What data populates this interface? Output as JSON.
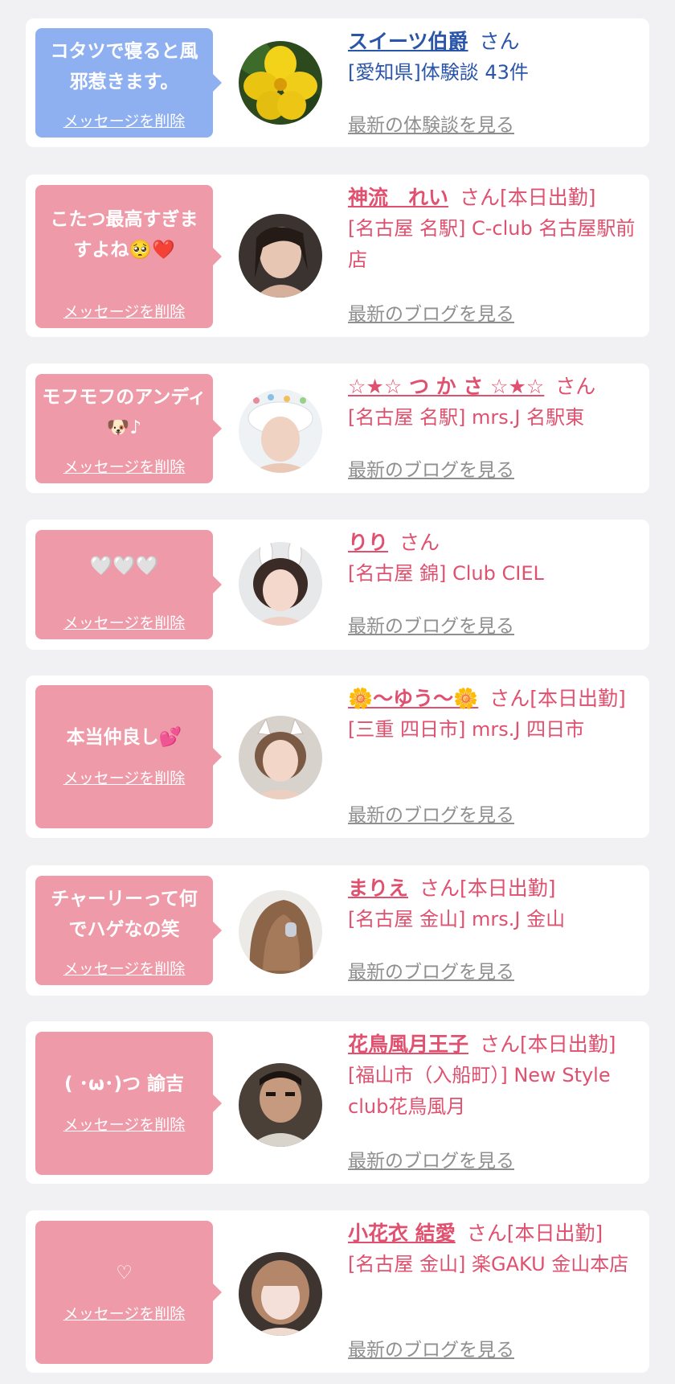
{
  "messages": [
    {
      "bubble": "コタツで寝ると風邪惹きます。",
      "delete_label": "メッセージを削除",
      "name": "スイーツ伯爵",
      "suffix": "さん",
      "location": "[愛知県]体験談 43件",
      "link": "最新の体験談を見る",
      "theme": "blue",
      "avatar": "yellow-hibiscus-flower"
    },
    {
      "bubble": "こたつ最高すぎますよね🥺❤️",
      "delete_label": "メッセージを削除",
      "name": "神流　れい",
      "suffix": "さん[本日出勤]",
      "location": "[名古屋 名駅] C-club 名古屋駅前店",
      "link": "最新のブログを見る",
      "theme": "pink",
      "avatar": "woman-portrait"
    },
    {
      "bubble": "モフモフのアンディ🐶♪",
      "delete_label": "メッセージを削除",
      "name": "☆★☆ つ か さ ☆★☆",
      "suffix": "さん",
      "location": "[名古屋 名駅] mrs.J 名駅東",
      "link": "最新のブログを見る",
      "theme": "pink",
      "avatar": "woman-portrait"
    },
    {
      "bubble": "🤍🤍🤍",
      "delete_label": "メッセージを削除",
      "name": "りり",
      "suffix": "さん",
      "location": "[名古屋 錦] Club CIEL",
      "link": "最新のブログを見る",
      "theme": "pink",
      "avatar": "woman-portrait"
    },
    {
      "bubble": "本当仲良し💕",
      "delete_label": "メッセージを削除",
      "name": "🌼〜ゆう〜🌼",
      "suffix": "さん[本日出勤]",
      "location": "[三重 四日市] mrs.J 四日市",
      "link": "最新のブログを見る",
      "theme": "pink",
      "avatar": "woman-portrait"
    },
    {
      "bubble": "チャーリーって何でハゲなの笑",
      "delete_label": "メッセージを削除",
      "name": "まりえ",
      "suffix": "さん[本日出勤]",
      "location": "[名古屋 金山] mrs.J 金山",
      "link": "最新のブログを見る",
      "theme": "pink",
      "avatar": "hair-back-view"
    },
    {
      "bubble": "( ･ω･)つ 諭吉",
      "delete_label": "メッセージを削除",
      "name": "花鳥風月王子",
      "suffix": "さん[本日出勤]",
      "location": "[福山市（入船町）] New Style club花鳥風月",
      "link": "最新のブログを見る",
      "theme": "pink",
      "avatar": "man-portrait"
    },
    {
      "bubble": "♡",
      "delete_label": "メッセージを削除",
      "name": "小花衣 結愛",
      "suffix": "さん[本日出勤]",
      "location": "[名古屋 金山] 楽GAKU 金山本店",
      "link": "最新のブログを見る",
      "theme": "pink",
      "avatar": "woman-portrait"
    }
  ],
  "colors": {
    "background": "#f1f1f3",
    "card": "#ffffff",
    "bubble_blue": "#8fb0f0",
    "bubble_pink": "#ee9aa8",
    "name_blue": "#2a55a8",
    "name_pink": "#e0506f",
    "link_gray": "#8f8f8f"
  }
}
